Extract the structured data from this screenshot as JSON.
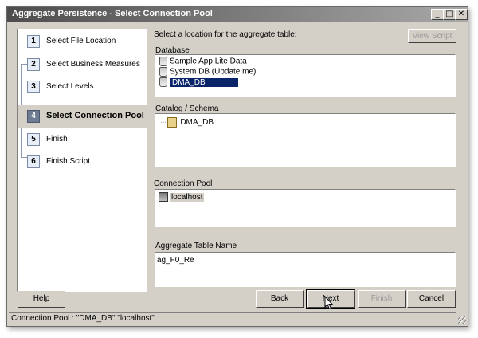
{
  "window": {
    "title": "Aggregate Persistence - Select Connection Pool"
  },
  "title_buttons": {
    "minimize": "_",
    "maximize": "□",
    "close": "✕"
  },
  "steps": [
    {
      "num": "1",
      "label": "Select File Location"
    },
    {
      "num": "2",
      "label": "Select Business Measures"
    },
    {
      "num": "3",
      "label": "Select Levels"
    },
    {
      "num": "4",
      "label": "Select Connection Pool"
    },
    {
      "num": "5",
      "label": "Finish"
    },
    {
      "num": "6",
      "label": "Finish Script"
    }
  ],
  "main": {
    "instruction": "Select a location for the aggregate table:",
    "view_script_label": "View Script",
    "database_label": "Database",
    "databases": [
      "Sample App Lite Data",
      "System DB (Update me)",
      "DMA_DB"
    ],
    "catalog_label": "Catalog / Schema",
    "catalog_item": "DMA_DB",
    "connection_pool_label": "Connection Pool",
    "connection_pool_item": "localhost",
    "aggregate_name_label": "Aggregate Table Name",
    "aggregate_name_value": "ag_F0_Re"
  },
  "buttons": {
    "help": "Help",
    "back": "Back",
    "next": "Next",
    "finish": "Finish",
    "cancel": "Cancel"
  },
  "status": "Connection Pool : \"DMA_DB\".\"localhost\""
}
